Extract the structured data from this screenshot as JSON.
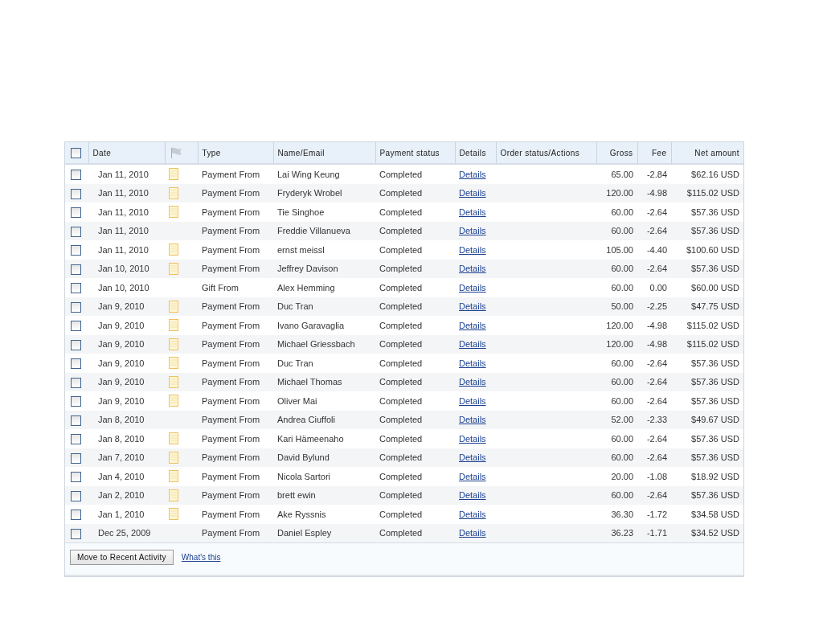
{
  "table": {
    "header_checkbox": {
      "checked": false
    },
    "columns": [
      "Date",
      "Type",
      "Name/Email",
      "Payment status",
      "Details",
      "Order status/Actions",
      "Gross",
      "Fee",
      "Net amount"
    ],
    "rows": [
      {
        "checked": false,
        "date": "Jan 11, 2010",
        "note": true,
        "type": "Payment From",
        "name": "Lai Wing Keung",
        "status": "Completed",
        "details": "Details",
        "gross": "65.00",
        "fee": "-2.84",
        "net": "$62.16 USD"
      },
      {
        "checked": false,
        "date": "Jan 11, 2010",
        "note": true,
        "type": "Payment From",
        "name": "Fryderyk Wrobel",
        "status": "Completed",
        "details": "Details",
        "gross": "120.00",
        "fee": "-4.98",
        "net": "$115.02 USD"
      },
      {
        "checked": false,
        "date": "Jan 11, 2010",
        "note": true,
        "type": "Payment From",
        "name": "Tie Singhoe",
        "status": "Completed",
        "details": "Details",
        "gross": "60.00",
        "fee": "-2.64",
        "net": "$57.36 USD"
      },
      {
        "checked": false,
        "date": "Jan 11, 2010",
        "note": false,
        "type": "Payment From",
        "name": "Freddie Villanueva",
        "status": "Completed",
        "details": "Details",
        "gross": "60.00",
        "fee": "-2.64",
        "net": "$57.36 USD"
      },
      {
        "checked": false,
        "date": "Jan 11, 2010",
        "note": true,
        "type": "Payment From",
        "name": "ernst meissl",
        "status": "Completed",
        "details": "Details",
        "gross": "105.00",
        "fee": "-4.40",
        "net": "$100.60 USD"
      },
      {
        "checked": false,
        "date": "Jan 10, 2010",
        "note": true,
        "type": "Payment From",
        "name": "Jeffrey Davison",
        "status": "Completed",
        "details": "Details",
        "gross": "60.00",
        "fee": "-2.64",
        "net": "$57.36 USD"
      },
      {
        "checked": false,
        "date": "Jan 10, 2010",
        "note": false,
        "type": "Gift From",
        "name": "Alex Hemming",
        "status": "Completed",
        "details": "Details",
        "gross": "60.00",
        "fee": "0.00",
        "net": "$60.00 USD"
      },
      {
        "checked": false,
        "date": "Jan 9, 2010",
        "note": true,
        "type": "Payment From",
        "name": "Duc Tran",
        "status": "Completed",
        "details": "Details",
        "gross": "50.00",
        "fee": "-2.25",
        "net": "$47.75 USD"
      },
      {
        "checked": false,
        "date": "Jan 9, 2010",
        "note": true,
        "type": "Payment From",
        "name": "Ivano Garavaglia",
        "status": "Completed",
        "details": "Details",
        "gross": "120.00",
        "fee": "-4.98",
        "net": "$115.02 USD"
      },
      {
        "checked": false,
        "date": "Jan 9, 2010",
        "note": true,
        "type": "Payment From",
        "name": "Michael Griessbach",
        "status": "Completed",
        "details": "Details",
        "gross": "120.00",
        "fee": "-4.98",
        "net": "$115.02 USD"
      },
      {
        "checked": false,
        "date": "Jan 9, 2010",
        "note": true,
        "type": "Payment From",
        "name": "Duc Tran",
        "status": "Completed",
        "details": "Details",
        "gross": "60.00",
        "fee": "-2.64",
        "net": "$57.36 USD"
      },
      {
        "checked": false,
        "date": "Jan 9, 2010",
        "note": true,
        "type": "Payment From",
        "name": "Michael Thomas",
        "status": "Completed",
        "details": "Details",
        "gross": "60.00",
        "fee": "-2.64",
        "net": "$57.36 USD"
      },
      {
        "checked": false,
        "date": "Jan 9, 2010",
        "note": true,
        "type": "Payment From",
        "name": "Oliver Mai",
        "status": "Completed",
        "details": "Details",
        "gross": "60.00",
        "fee": "-2.64",
        "net": "$57.36 USD"
      },
      {
        "checked": false,
        "date": "Jan 8, 2010",
        "note": false,
        "type": "Payment From",
        "name": "Andrea Ciuffoli",
        "status": "Completed",
        "details": "Details",
        "gross": "52.00",
        "fee": "-2.33",
        "net": "$49.67 USD"
      },
      {
        "checked": false,
        "date": "Jan 8, 2010",
        "note": true,
        "type": "Payment From",
        "name": "Kari Hämeenaho",
        "status": "Completed",
        "details": "Details",
        "gross": "60.00",
        "fee": "-2.64",
        "net": "$57.36 USD"
      },
      {
        "checked": false,
        "date": "Jan 7, 2010",
        "note": true,
        "type": "Payment From",
        "name": "David Bylund",
        "status": "Completed",
        "details": "Details",
        "gross": "60.00",
        "fee": "-2.64",
        "net": "$57.36 USD"
      },
      {
        "checked": false,
        "date": "Jan 4, 2010",
        "note": true,
        "type": "Payment From",
        "name": "Nicola Sartori",
        "status": "Completed",
        "details": "Details",
        "gross": "20.00",
        "fee": "-1.08",
        "net": "$18.92 USD"
      },
      {
        "checked": false,
        "date": "Jan 2, 2010",
        "note": true,
        "type": "Payment From",
        "name": "brett ewin",
        "status": "Completed",
        "details": "Details",
        "gross": "60.00",
        "fee": "-2.64",
        "net": "$57.36 USD"
      },
      {
        "checked": false,
        "date": "Jan 1, 2010",
        "note": true,
        "type": "Payment From",
        "name": "Ake Ryssnis",
        "status": "Completed",
        "details": "Details",
        "gross": "36.30",
        "fee": "-1.72",
        "net": "$34.58 USD"
      },
      {
        "checked": false,
        "date": "Dec 25, 2009",
        "note": false,
        "type": "Payment From",
        "name": "Daniel Espley",
        "status": "Completed",
        "details": "Details",
        "gross": "36.23",
        "fee": "-1.71",
        "net": "$34.52 USD"
      }
    ]
  },
  "footer": {
    "button": "Move to Recent Activity",
    "link": "What's this"
  }
}
